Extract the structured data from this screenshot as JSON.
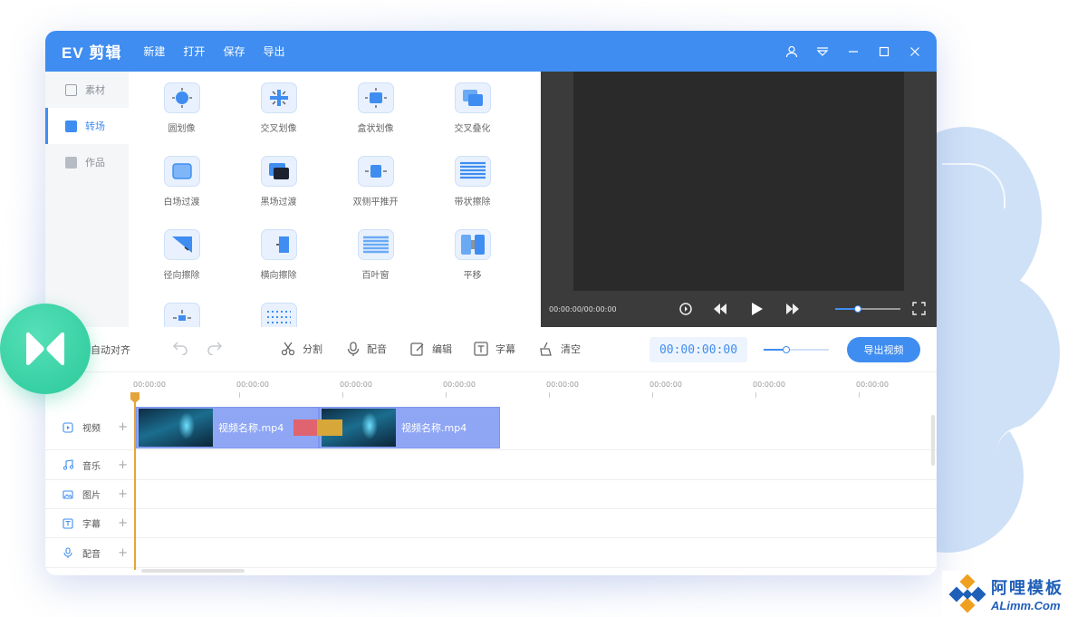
{
  "app": {
    "title": "EV 剪辑",
    "menu": [
      "新建",
      "打开",
      "保存",
      "导出"
    ]
  },
  "sidebar": {
    "items": [
      {
        "label": "素材",
        "icon": "grid-icon",
        "active": false
      },
      {
        "label": "转场",
        "icon": "transition-icon",
        "active": true
      },
      {
        "label": "作品",
        "icon": "folder-icon",
        "active": false
      }
    ]
  },
  "transitions": {
    "items": [
      {
        "label": "圆划像"
      },
      {
        "label": "交叉划像"
      },
      {
        "label": "盒状划像"
      },
      {
        "label": "交叉叠化"
      },
      {
        "label": "白场过渡"
      },
      {
        "label": "黑场过渡"
      },
      {
        "label": "双侧平推开"
      },
      {
        "label": "带状擦除"
      },
      {
        "label": "径向擦除"
      },
      {
        "label": "横向擦除"
      },
      {
        "label": "百叶窗"
      },
      {
        "label": "平移"
      },
      {
        "label": ""
      },
      {
        "label": ""
      }
    ]
  },
  "preview": {
    "time": "00:00:00/00:00:00",
    "volume": 0.35
  },
  "toolbar": {
    "auto_align": "自动对齐",
    "split": "分割",
    "dub": "配音",
    "edit": "编辑",
    "subtitle": "字幕",
    "clear": "清空",
    "timecode": "00:00:00:00",
    "zoom": 0.35,
    "export": "导出视频"
  },
  "ruler": {
    "labels": [
      "00:00:00",
      "00:00:00",
      "00:00:00",
      "00:00:00",
      "00:00:00",
      "00:00:00",
      "00:00:00",
      "00:00:00"
    ]
  },
  "tracks": [
    {
      "label": "视频",
      "icon": "video-icon"
    },
    {
      "label": "音乐",
      "icon": "music-icon"
    },
    {
      "label": "图片",
      "icon": "image-icon"
    },
    {
      "label": "字幕",
      "icon": "text-icon"
    },
    {
      "label": "配音",
      "icon": "mic-icon"
    }
  ],
  "clips": [
    {
      "name": "视频名称.mp4"
    },
    {
      "name": "视频名称.mp4"
    }
  ],
  "watermark": {
    "cn": "阿哩模板",
    "en": "ALimm.Com"
  },
  "colors": {
    "accent": "#3f8df0",
    "clip": "#8fa6f5",
    "playhead": "#e4a53a",
    "badge": "#2ac99a"
  }
}
